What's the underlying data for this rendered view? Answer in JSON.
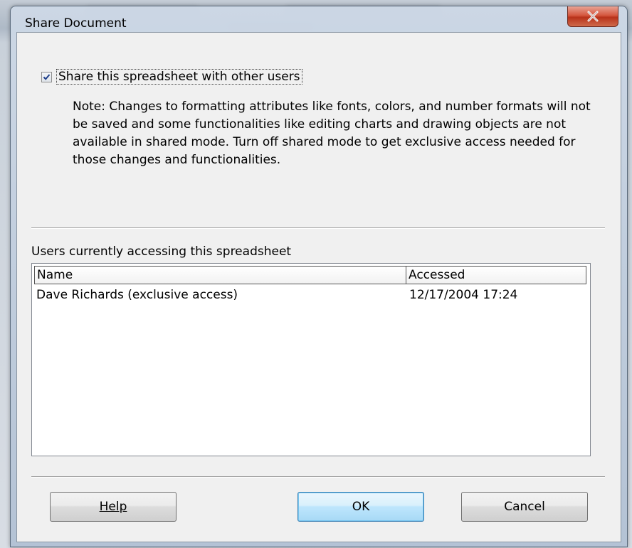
{
  "window": {
    "title": "Share Document",
    "close_glyph": "X"
  },
  "share": {
    "checked": true,
    "label": "Share this spreadsheet with other users",
    "note": "Note: Changes to formatting attributes like fonts, colors, and number formats will not be saved and some functionalities like editing charts and drawing objects are not available in shared mode. Turn off shared mode to get exclusive access needed for those changes and functionalities."
  },
  "users": {
    "label": "Users currently accessing this spreadsheet",
    "columns": [
      "Name",
      "Accessed"
    ],
    "rows": [
      {
        "name": "Dave Richards (exclusive access)",
        "accessed": "12/17/2004 17:24"
      }
    ]
  },
  "buttons": {
    "help": "Help",
    "ok": "OK",
    "cancel": "Cancel"
  },
  "colors": {
    "close_button": "#d5583f",
    "ok_button_border": "#3c7fb1",
    "dialog_bg": "#f0f0f0"
  }
}
